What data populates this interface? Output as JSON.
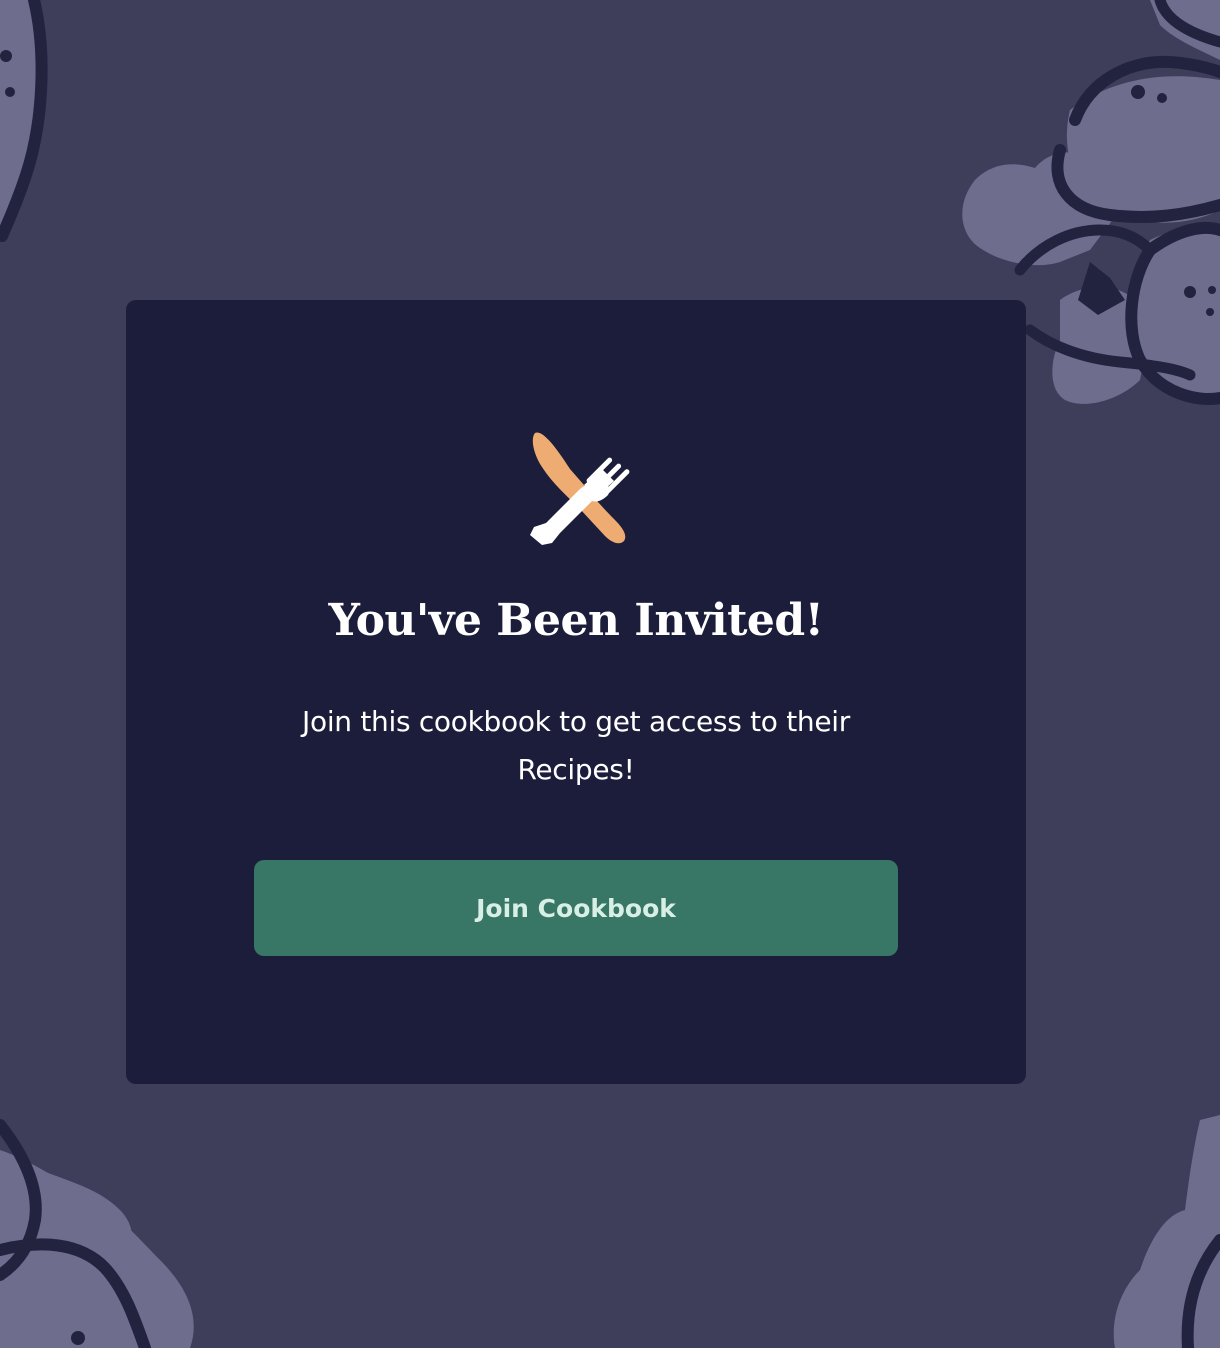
{
  "invite": {
    "title": "You've Been Invited!",
    "message": "Join this cookbook to get access to their Recipes!",
    "join_button_label": "Join Cookbook",
    "logo_icon": "knife-and-fork-icon"
  },
  "colors": {
    "page_background": "#3e3d5a",
    "card_background": "#1c1d3a",
    "button_background": "#387666",
    "button_text": "#d8efe5",
    "knife_color": "#eeac73",
    "fork_color": "#ffffff",
    "decor_fill": "#6f6d8e",
    "decor_outline": "#22233f"
  }
}
